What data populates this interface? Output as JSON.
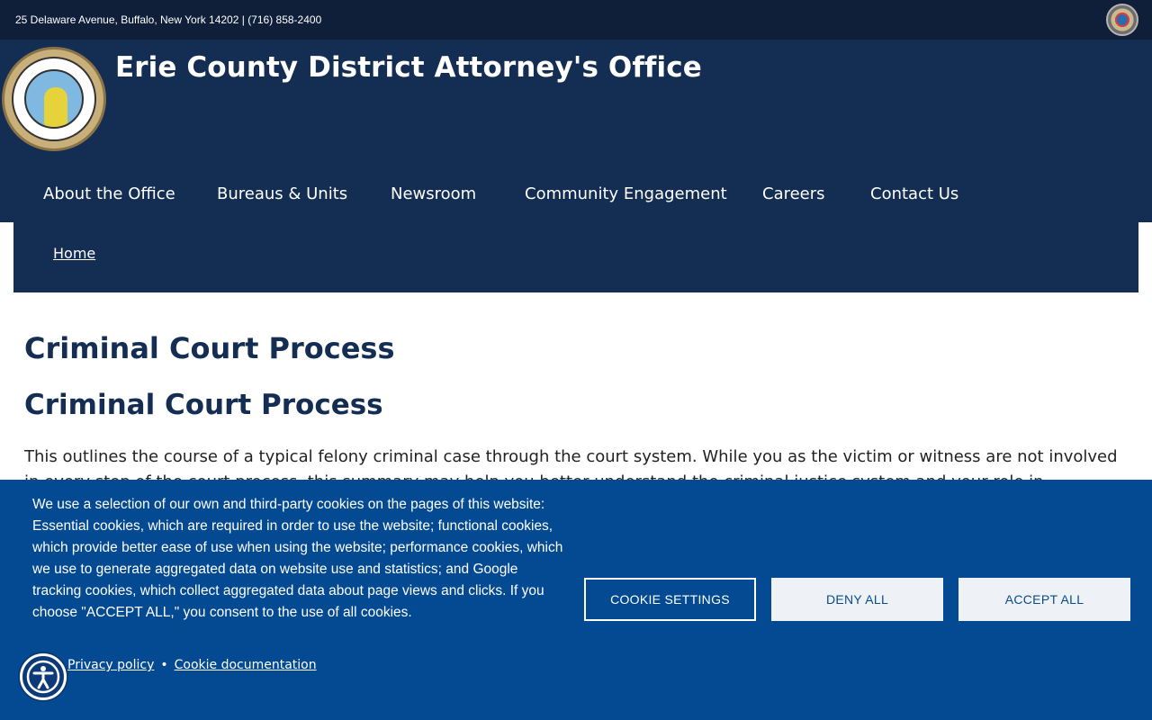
{
  "topbar": {
    "address": "25 Delaware Avenue, Buffalo, New York 14202 | (716) 858-2400",
    "seal_icon": "county-seal-icon"
  },
  "header": {
    "logo_icon": "da-office-seal-icon",
    "title": "Erie County District Attorney's Office"
  },
  "nav": {
    "items": [
      {
        "label": "About the Office"
      },
      {
        "label": "Bureaus & Units"
      },
      {
        "label": "Newsroom"
      },
      {
        "label": "Community Engagement"
      },
      {
        "label": "Careers"
      },
      {
        "label": "Contact Us"
      }
    ]
  },
  "breadcrumb": {
    "home": "Home"
  },
  "main": {
    "page_title": "Criminal Court Process",
    "section_title": "Criminal Court Process",
    "intro": "This outlines the course of a typical felony criminal case through the court system. While you as the victim or witness are not involved in every step of the court process, this summary may help you better understand the criminal justice system and your role in"
  },
  "cookie_banner": {
    "text": "We use a selection of our own and third-party cookies on the pages of this website: Essential cookies, which are required in order to use the website; functional cookies, which provide better ease of use when using the website; performance cookies, which we use to generate aggregated data on website use and statistics; and Google tracking cookies, which collect aggregated data about page views and clicks. If you choose \"ACCEPT ALL,\" you consent to the use of all cookies.",
    "privacy_link": "Privacy policy",
    "separator": "•",
    "cookie_doc_link": "Cookie documentation",
    "settings_button": "COOKIE SETTINGS",
    "deny_button": "DENY ALL",
    "accept_button": "ACCEPT ALL"
  },
  "accessibility": {
    "icon": "accessibility-icon"
  },
  "colors": {
    "topbar_bg": "#0f1f3a",
    "header_bg": "#132d53",
    "cookie_bg": "#034a93",
    "heading": "#132d53"
  }
}
